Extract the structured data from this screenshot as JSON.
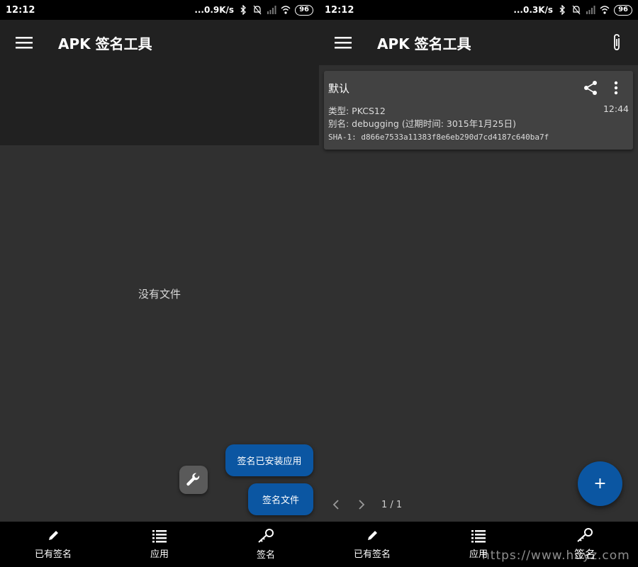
{
  "colors": {
    "accent": "#0b56a2",
    "toolbar": "#212121",
    "background": "#303030",
    "card": "#424242"
  },
  "left_screen": {
    "status_bar": {
      "time": "12:12",
      "network_speed": "...0.9K/s",
      "battery": "96"
    },
    "toolbar": {
      "title": "APK 签名工具",
      "menu_icon": "menu-icon"
    },
    "empty_message": "没有文件",
    "fab_actions": {
      "sign_installed": "签名已安装应用",
      "sign_file": "签名文件",
      "wrench_icon": "wrench-icon"
    },
    "bottom_nav": [
      {
        "label": "已有签名",
        "icon": "pencil-icon"
      },
      {
        "label": "应用",
        "icon": "list-icon"
      },
      {
        "label": "签名",
        "icon": "key-icon"
      }
    ]
  },
  "right_screen": {
    "status_bar": {
      "time": "12:12",
      "network_speed": "...0.3K/s",
      "battery": "96"
    },
    "toolbar": {
      "title": "APK 签名工具",
      "menu_icon": "menu-icon",
      "attach_icon": "paperclip-icon"
    },
    "card": {
      "title": "默认",
      "type": "类型: PKCS12",
      "time": "12:44",
      "alias": "别名: debugging (过期时间: 3015年1月25日)",
      "sha1": "SHA-1: d866e7533a11383f8e6eb290d7cd4187c640ba7f"
    },
    "pager": {
      "page_info": "1 / 1"
    },
    "fab_add_label": "+",
    "bottom_nav": [
      {
        "label": "已有签名",
        "icon": "pencil-icon"
      },
      {
        "label": "应用",
        "icon": "list-icon"
      },
      {
        "label": "签名",
        "icon": "key-icon"
      }
    ]
  },
  "watermark": "https://www.huyz.com"
}
